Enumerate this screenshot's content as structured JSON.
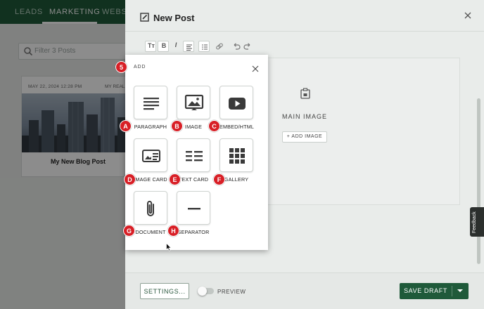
{
  "background": {
    "nav_tabs": [
      {
        "label": "LEADS",
        "active": false
      },
      {
        "label": "MARKETING",
        "active": true
      },
      {
        "label": "WEBS",
        "active": false
      }
    ],
    "search_placeholder": "Filter 3 Posts",
    "post_card": {
      "date": "MAY 22, 2024 12:28 PM",
      "badge": "MY REAL",
      "title": "My New Blog Post"
    }
  },
  "drawer": {
    "title": "New Post",
    "toolbar_icons": [
      "text-size-icon",
      "bold-icon",
      "italic-icon",
      "align-icon",
      "list-icon",
      "link-icon",
      "undo-icon",
      "redo-icon"
    ],
    "main_image_label": "MAIN IMAGE",
    "add_image_button": "+ ADD IMAGE",
    "footer": {
      "settings_button": "SETTINGS...",
      "preview_label": "PREVIEW",
      "preview_on": false,
      "save_button": "SAVE DRAFT"
    },
    "feedback_tab": "Feedback"
  },
  "add_modal": {
    "title": "ADD",
    "step_marker": "5",
    "items": [
      {
        "marker": "A",
        "label": "PARAGRAPH",
        "icon": "paragraph-icon"
      },
      {
        "marker": "B",
        "label": "IMAGE",
        "icon": "image-icon"
      },
      {
        "marker": "C",
        "label": "EMBED/HTML",
        "icon": "embed-play-icon"
      },
      {
        "marker": "D",
        "label": "IMAGE CARD",
        "icon": "image-card-icon"
      },
      {
        "marker": "E",
        "label": "TEXT CARD",
        "icon": "text-card-icon"
      },
      {
        "marker": "F",
        "label": "GALLERY",
        "icon": "gallery-grid-icon"
      },
      {
        "marker": "G",
        "label": "DOCUMENT",
        "icon": "paperclip-icon"
      },
      {
        "marker": "H",
        "label": "SEPARATOR",
        "icon": "separator-icon"
      }
    ]
  },
  "colors": {
    "brand_green": "#1f5a3a",
    "marker_red": "#d81f26"
  }
}
